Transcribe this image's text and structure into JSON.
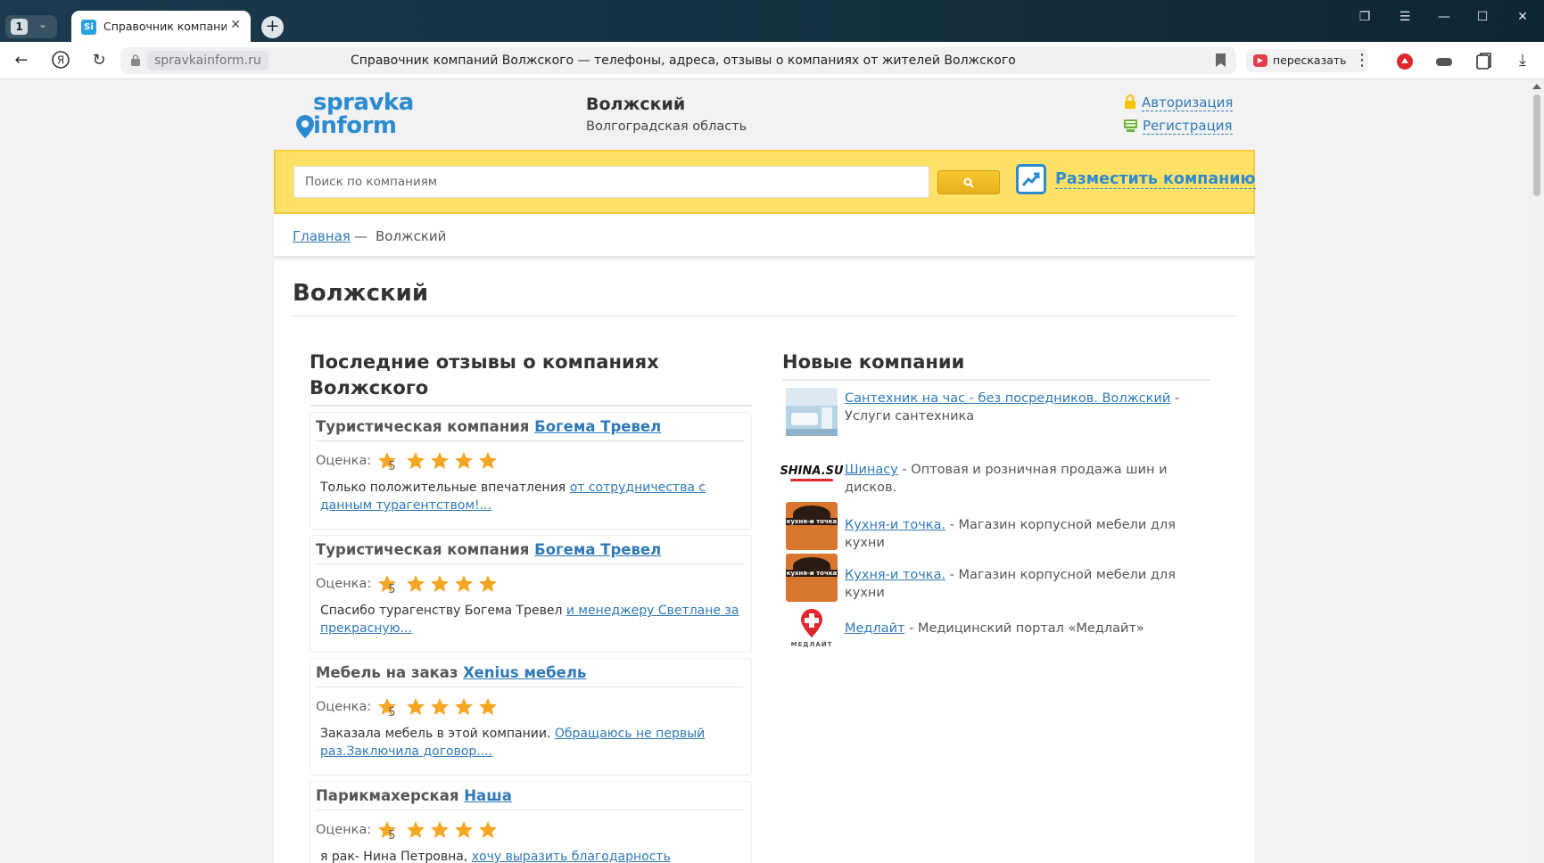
{
  "browser": {
    "tab_count": "1",
    "tab_title": "Справочник компаний",
    "tab_favicon": "Si",
    "domain": "spravkainform.ru",
    "page_title": "Справочник компаний Волжского — телефоны, адреса, отзывы о компаниях от жителей Волжского",
    "retell_label": "пересказать"
  },
  "header": {
    "logo_line1": "spravka",
    "logo_line2": "inform",
    "city": "Волжский",
    "region": "Волгоградская область",
    "auth_label": "Авторизация",
    "register_label": "Регистрация"
  },
  "search": {
    "placeholder": "Поиск по компаниям",
    "place_company_label": "Разместить компанию"
  },
  "breadcrumb": {
    "home": "Главная",
    "separator": "—",
    "current": "Волжский"
  },
  "main": {
    "title": "Волжский",
    "reviews_title": "Последние отзывы о компаниях Волжского",
    "rating_label": "Оценка:",
    "reviews": [
      {
        "category": "Туристическая компания",
        "company": "Богема Тревел",
        "rating": "5",
        "text": "Только положительные впечатления",
        "link": "от сотрудничества с данным турагентством!..."
      },
      {
        "category": "Туристическая компания",
        "company": "Богема Тревел",
        "rating": "5",
        "text": "Спасибо турагенству Богема Тревел",
        "link": "и менеджеру Светлане за прекрасную..."
      },
      {
        "category": "Мебель на заказ",
        "company": "Xenius мебель",
        "rating": "5",
        "text": "Заказала мебель в этой компании.",
        "link": "Обращаюсь не первый раз.Заключила договор...."
      },
      {
        "category": "Парикмахерская",
        "company": "Наша",
        "rating": "5",
        "text": "я рак- Нина Петровна,",
        "link": "хочу выразить благодарность"
      }
    ],
    "new_title": "Новые компании",
    "new_companies": [
      {
        "name": "Сантехник на час - без посредников. Волжский",
        "desc": " - Услуги сантехника"
      },
      {
        "name": "Шинасу",
        "desc": " - Оптовая и розничная продажа шин и дисков.",
        "logo_text": "SHINA.SU"
      },
      {
        "name": "Кухня-и точка.",
        "desc": " - Магазин корпусной мебели для кухни",
        "logo_text": "кухня-и точка"
      },
      {
        "name": "Кухня-и точка.",
        "desc": " - Магазин корпусной мебели для кухни",
        "logo_text": "кухня-и точка"
      },
      {
        "name": "Медлайт",
        "desc": " - Медицинский портал «Медлайт»",
        "logo_text": "МЕДЛАЙТ"
      }
    ]
  },
  "colors": {
    "accent": "#2f79b8",
    "search_bar": "#fee267",
    "star": "#f5a623"
  }
}
